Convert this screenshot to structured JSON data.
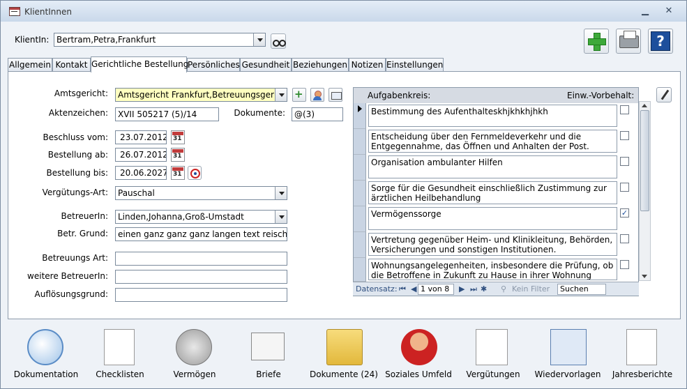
{
  "window": {
    "title": "KlientInnen"
  },
  "client": {
    "label": "KlientIn:",
    "value": "Bertram,Petra,Frankfurt"
  },
  "tabs": [
    "Allgemein",
    "Kontakt",
    "Gerichtliche Bestellung",
    "Persönliches",
    "Gesundheit",
    "Beziehungen",
    "Notizen",
    "Einstellungen"
  ],
  "form": {
    "amtsgericht_label": "Amtsgericht:",
    "amtsgericht_value": "Amtsgericht Frankfurt,Betreuungsgericht",
    "aktenzeichen_label": "Aktenzeichen:",
    "aktenzeichen_value": "XVII 505217 (5)/14",
    "dokumente_label": "Dokumente:",
    "dokumente_value": "@(3)",
    "beschluss_label": "Beschluss vom:",
    "beschluss_value": "23.07.2012",
    "bestellung_ab_label": "Bestellung ab:",
    "bestellung_ab_value": "26.07.2012",
    "bestellung_bis_label": "Bestellung bis:",
    "bestellung_bis_value": "20.06.2027",
    "verguetung_label": "Vergütungs-Art:",
    "verguetung_value": "Pauschal",
    "betreuer_label": "BetreuerIn:",
    "betreuer_value": "Linden,Johanna,Groß-Umstadt",
    "grund_label": "Betr. Grund:",
    "grund_value": "einen ganz ganz ganz langen text reischreiben",
    "art_label": "Betreuungs Art:",
    "art_value": "",
    "weitere_label": "weitere BetreuerIn:",
    "weitere_value": "",
    "aufloesung_label": "Auflösungsgrund:",
    "aufloesung_value": "",
    "cal_day": "31"
  },
  "aufgaben": {
    "header_left": "Aufgabenkreis:",
    "header_right": "Einw.-Vorbehalt:",
    "rows": [
      {
        "text": "Bestimmung des Aufenthalteskhjkhkhjhkh",
        "checked": false
      },
      {
        "text": "Entscheidung über den Fernmeldeverkehr und die Entgegennahme, das Öffnen und Anhalten der Post.",
        "checked": false
      },
      {
        "text": "Organisation ambulanter Hilfen",
        "checked": false
      },
      {
        "text": "Sorge für die Gesundheit einschließlich Zustimmung zur ärztlichen Heilbehandlung",
        "checked": false
      },
      {
        "text": "Vermögenssorge",
        "checked": true
      },
      {
        "text": "Vertretung gegenüber Heim- und Klinikleitung, Behörden, Versicherungen und sonstigen Institutionen.",
        "checked": false
      },
      {
        "text": "Wohnungsangelegenheiten, insbesondere die Prüfung, ob die Betroffene in Zukunft zu Hause in ihrer Wohnung leben",
        "checked": false
      }
    ],
    "nav": {
      "label": "Datensatz:",
      "record": "1 von 8",
      "filter": "Kein Filter",
      "search": "Suchen"
    }
  },
  "bottom": [
    "Dokumentation",
    "Checklisten",
    "Vermögen",
    "Briefe",
    "Dokumente (24)",
    "Soziales Umfeld",
    "Vergütungen",
    "Wiedervorlagen",
    "Jahresberichte"
  ],
  "colors": {
    "title_bg": "#c9d8ea",
    "panel_bg": "#ffffff",
    "highlight": "#ffffc0",
    "accent": "#1d4f9c"
  }
}
